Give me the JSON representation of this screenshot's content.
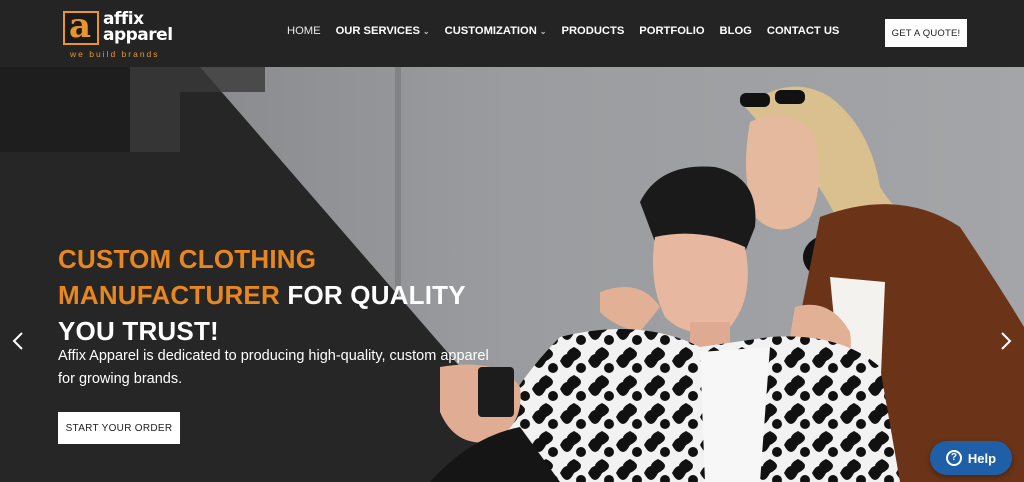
{
  "header": {
    "logo": {
      "line1": "affix",
      "line2": "apparel",
      "tagline": "we build brands",
      "mark": "a"
    },
    "nav": [
      {
        "label": "HOME",
        "dropdown": false
      },
      {
        "label": "OUR SERVICES",
        "dropdown": true
      },
      {
        "label": "CUSTOMIZATION",
        "dropdown": true
      },
      {
        "label": "PRODUCTS",
        "dropdown": false
      },
      {
        "label": "PORTFOLIO",
        "dropdown": false
      },
      {
        "label": "BLOG",
        "dropdown": false
      },
      {
        "label": "CONTACT US",
        "dropdown": false
      }
    ],
    "quote_button": "GET A QUOTE!"
  },
  "hero": {
    "headline_orange_1": "CUSTOM CLOTHING",
    "headline_orange_2": "MANUFACTURER",
    "headline_white_2": " FOR QUALITY",
    "headline_white_3": "YOU TRUST!",
    "subtext": "Affix Apparel is dedicated to producing high-quality, custom apparel for growing brands.",
    "cta_button": "START YOUR ORDER",
    "prev_icon": "chevron-left-icon",
    "next_icon": "chevron-right-icon"
  },
  "help_widget": {
    "label": "Help",
    "icon": "question-circle-icon"
  },
  "colors": {
    "accent": "#e8861f",
    "header_bg": "#242424",
    "help_bg": "#1f5fa8"
  }
}
